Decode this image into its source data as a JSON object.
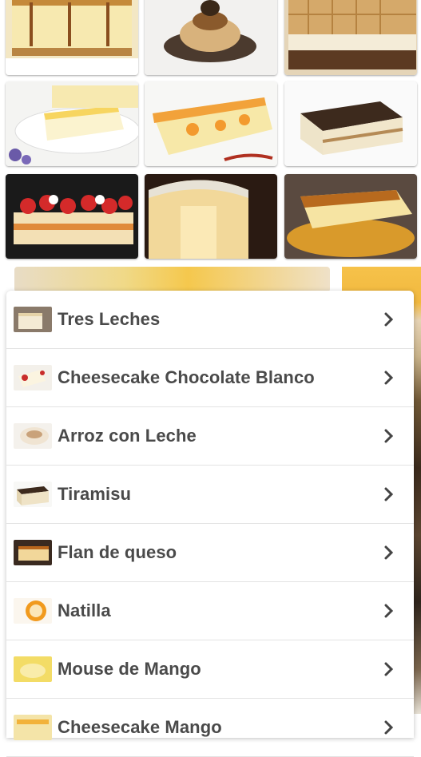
{
  "recipes": [
    {
      "label": "Tres Leches"
    },
    {
      "label": "Cheesecake Chocolate Blanco"
    },
    {
      "label": "Arroz con Leche"
    },
    {
      "label": "Tiramisu"
    },
    {
      "label": "Flan de queso"
    },
    {
      "label": "Natilla"
    },
    {
      "label": "Mouse de Mango"
    },
    {
      "label": "Cheesecake Mango"
    }
  ],
  "colors": {
    "text": "#4a4a4a",
    "divider": "#e3e3e3",
    "chevron": "#444444"
  },
  "icons": {
    "chevron": "chevron-right-icon"
  }
}
